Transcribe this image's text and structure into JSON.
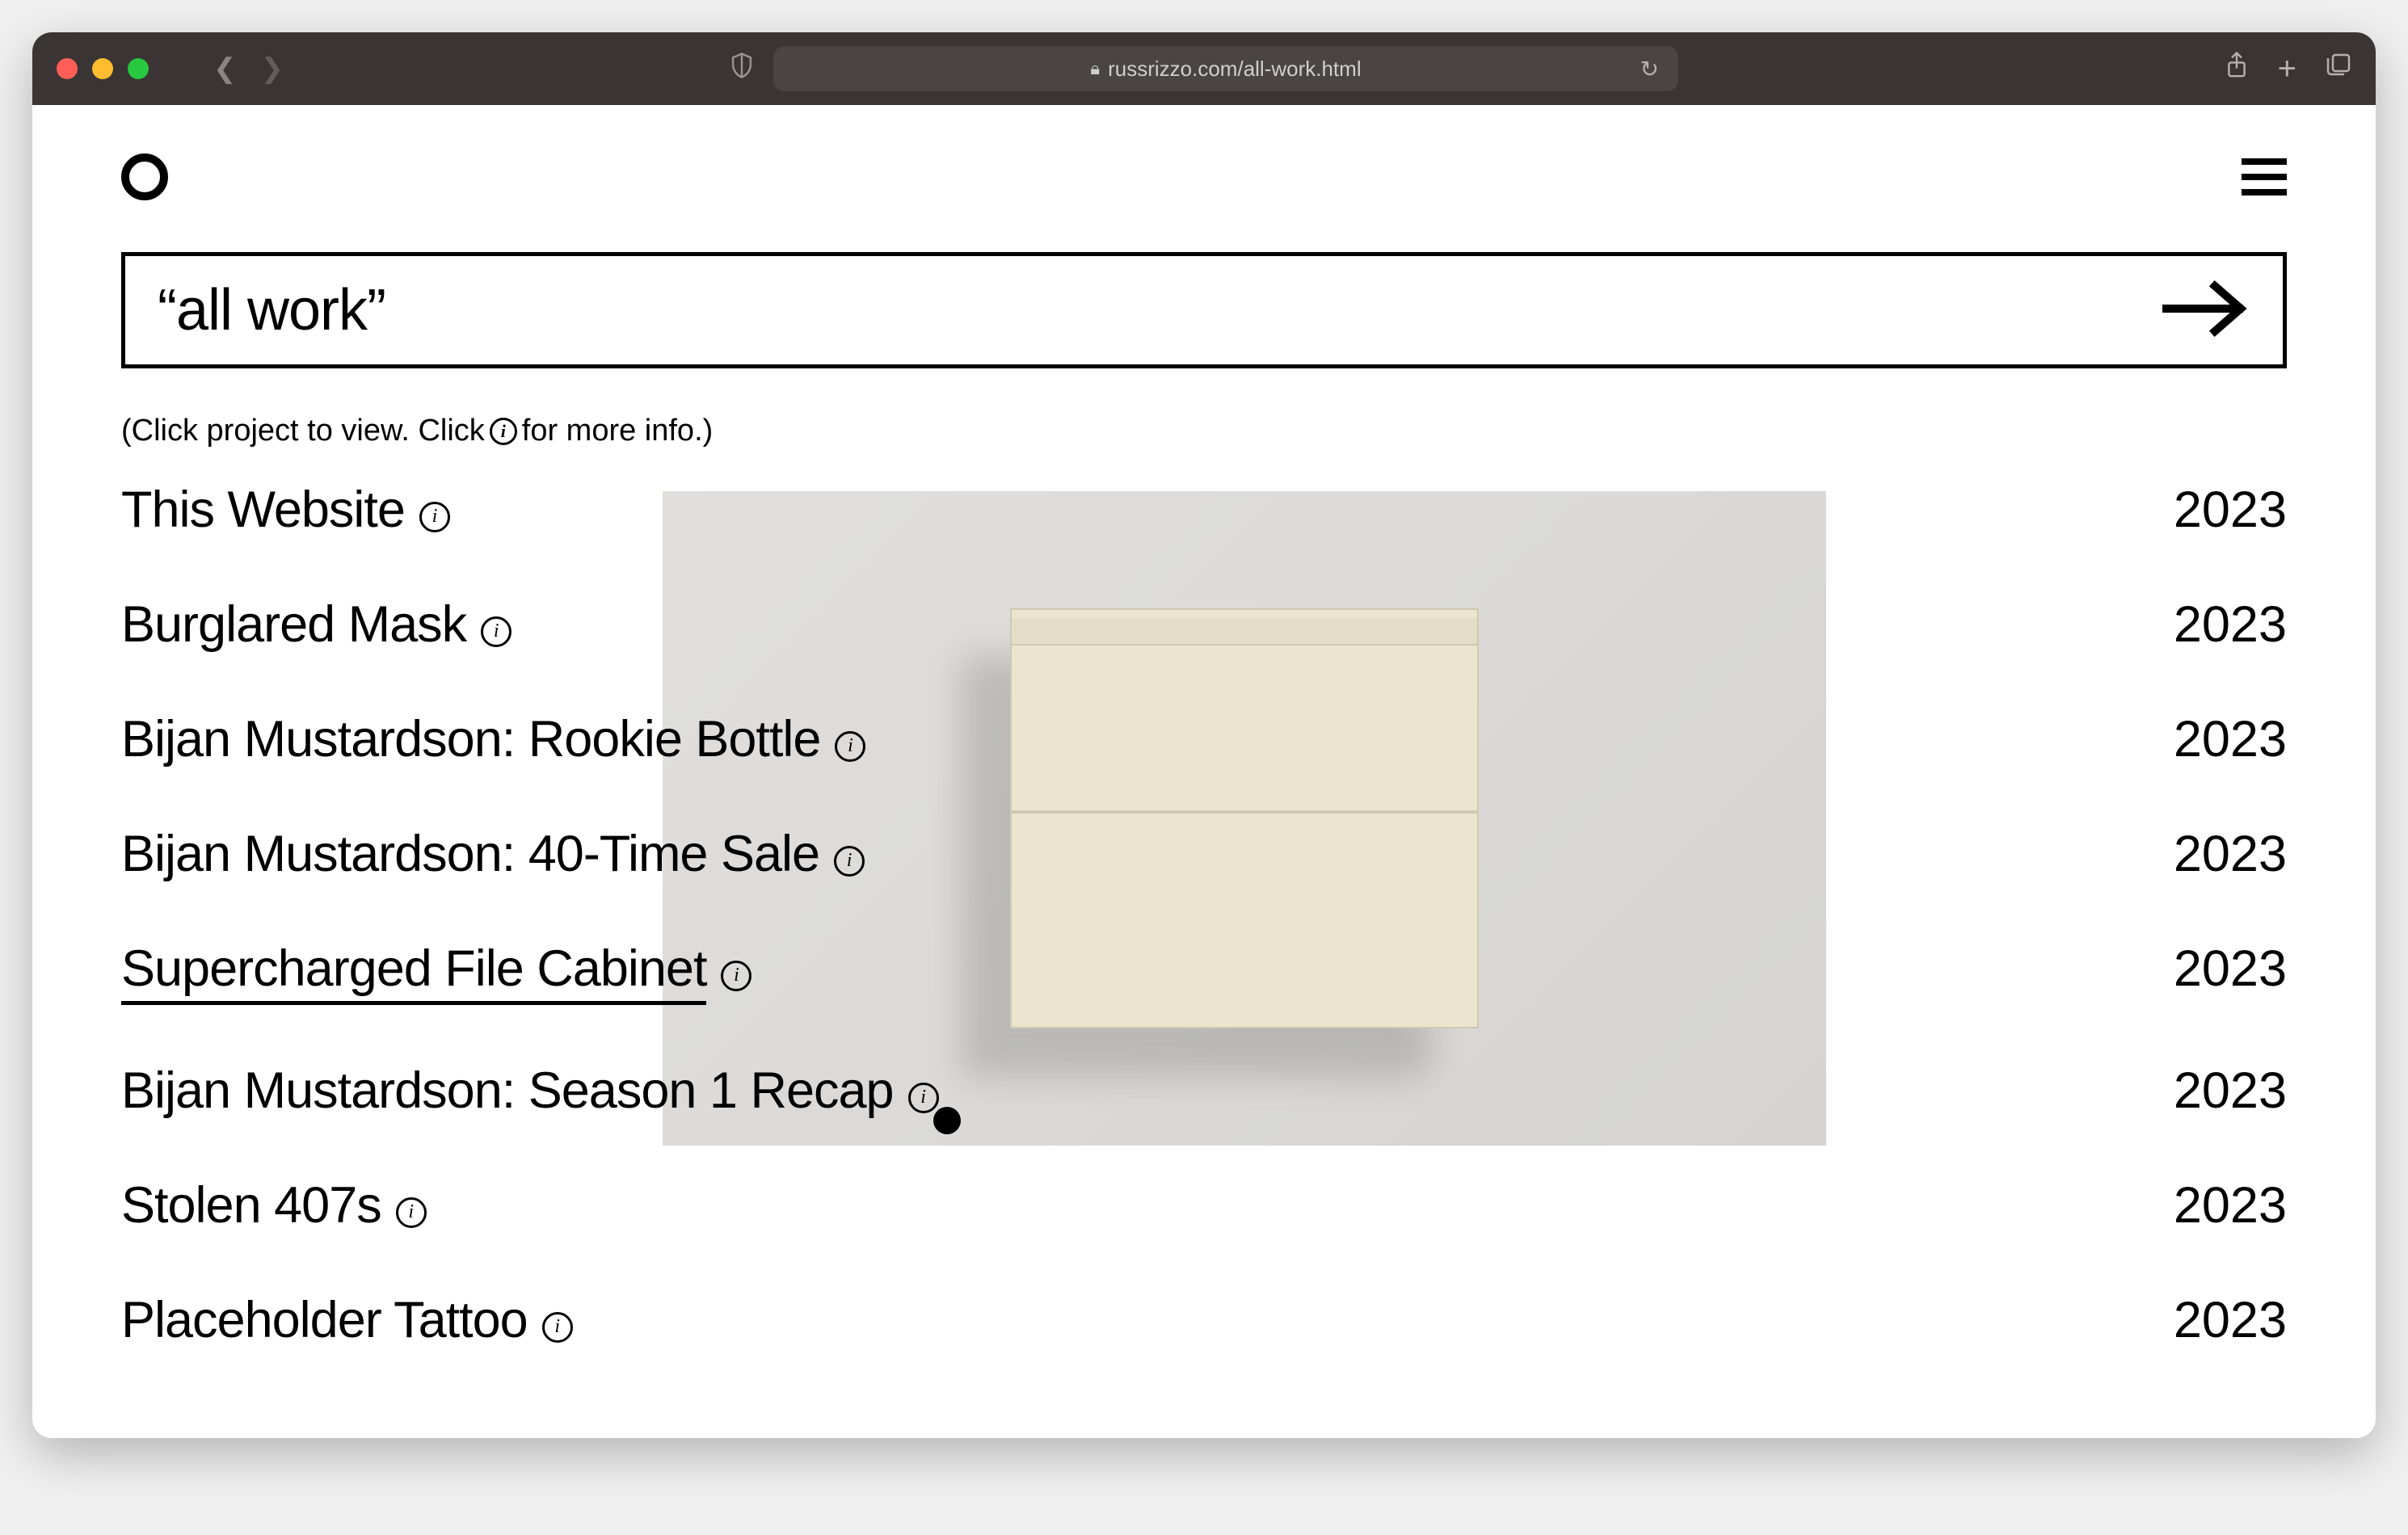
{
  "browser": {
    "url": "russrizzo.com/all-work.html"
  },
  "page": {
    "search_label": "“all work”",
    "helper_prefix": "(Click project to view. Click ",
    "helper_suffix": " for more info.)"
  },
  "projects": [
    {
      "title": "This Website",
      "year": "2023",
      "active": false
    },
    {
      "title": "Burglared Mask",
      "year": "2023",
      "active": false
    },
    {
      "title": "Bijan Mustardson: Rookie Bottle",
      "year": "2023",
      "active": false
    },
    {
      "title": "Bijan Mustardson: 40-Time Sale",
      "year": "2023",
      "active": false
    },
    {
      "title": "Supercharged File Cabinet",
      "year": "2023",
      "active": true
    },
    {
      "title": "Bijan Mustardson: Season 1 Recap",
      "year": "2023",
      "active": false
    },
    {
      "title": "Stolen 407s",
      "year": "2023",
      "active": false
    },
    {
      "title": "Placeholder Tattoo",
      "year": "2023",
      "active": false
    }
  ]
}
